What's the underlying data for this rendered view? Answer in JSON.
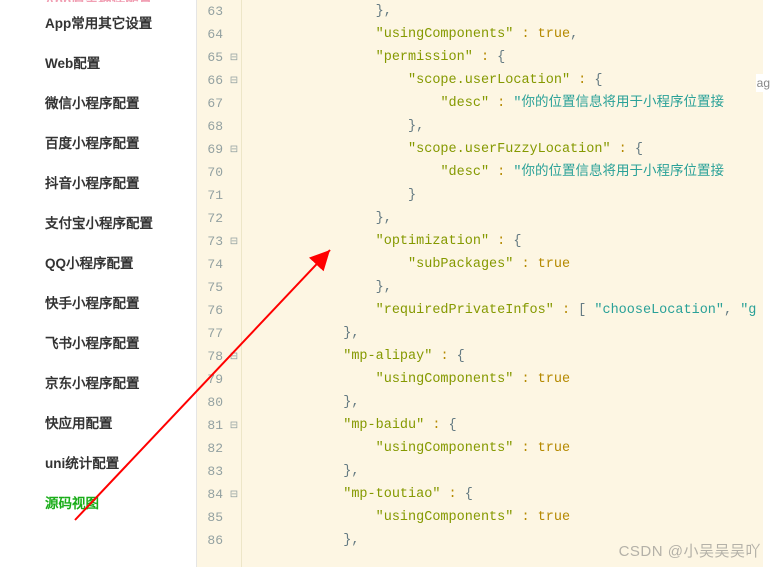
{
  "sidebar": {
    "items": [
      {
        "label": "App原生插件配置"
      },
      {
        "label": "App常用其它设置"
      },
      {
        "label": "Web配置"
      },
      {
        "label": "微信小程序配置"
      },
      {
        "label": "百度小程序配置"
      },
      {
        "label": "抖音小程序配置"
      },
      {
        "label": "支付宝小程序配置"
      },
      {
        "label": "QQ小程序配置"
      },
      {
        "label": "快手小程序配置"
      },
      {
        "label": "飞书小程序配置"
      },
      {
        "label": "京东小程序配置"
      },
      {
        "label": "快应用配置"
      },
      {
        "label": "uni统计配置"
      },
      {
        "label": "源码视图"
      }
    ]
  },
  "editor": {
    "lines": [
      {
        "num": 63,
        "fold": "",
        "indent": 4,
        "tokens": [
          {
            "t": "},",
            "c": "p"
          }
        ]
      },
      {
        "num": 64,
        "fold": "",
        "indent": 4,
        "tokens": [
          {
            "t": "\"usingComponents\"",
            "c": "k"
          },
          {
            "t": " : ",
            "c": "c"
          },
          {
            "t": "true",
            "c": "b"
          },
          {
            "t": ",",
            "c": "p"
          }
        ]
      },
      {
        "num": 65,
        "fold": "⊟",
        "indent": 4,
        "tokens": [
          {
            "t": "\"permission\"",
            "c": "k"
          },
          {
            "t": " : ",
            "c": "c"
          },
          {
            "t": "{",
            "c": "p"
          }
        ]
      },
      {
        "num": 66,
        "fold": "⊟",
        "indent": 5,
        "tokens": [
          {
            "t": "\"scope.userLocation\"",
            "c": "k"
          },
          {
            "t": " : ",
            "c": "c"
          },
          {
            "t": "{",
            "c": "p"
          }
        ]
      },
      {
        "num": 67,
        "fold": "",
        "indent": 6,
        "tokens": [
          {
            "t": "\"desc\"",
            "c": "k"
          },
          {
            "t": " : ",
            "c": "c"
          },
          {
            "t": "\"你的位置信息将用于小程序位置接",
            "c": "s"
          }
        ]
      },
      {
        "num": 68,
        "fold": "",
        "indent": 5,
        "tokens": [
          {
            "t": "},",
            "c": "p"
          }
        ]
      },
      {
        "num": 69,
        "fold": "⊟",
        "indent": 5,
        "tokens": [
          {
            "t": "\"scope.userFuzzyLocation\"",
            "c": "k"
          },
          {
            "t": " : ",
            "c": "c"
          },
          {
            "t": "{",
            "c": "p"
          }
        ]
      },
      {
        "num": 70,
        "fold": "",
        "indent": 6,
        "tokens": [
          {
            "t": "\"desc\"",
            "c": "k"
          },
          {
            "t": " : ",
            "c": "c"
          },
          {
            "t": "\"你的位置信息将用于小程序位置接",
            "c": "s"
          }
        ]
      },
      {
        "num": 71,
        "fold": "",
        "indent": 5,
        "tokens": [
          {
            "t": "}",
            "c": "p"
          }
        ]
      },
      {
        "num": 72,
        "fold": "",
        "indent": 4,
        "tokens": [
          {
            "t": "},",
            "c": "p"
          }
        ]
      },
      {
        "num": 73,
        "fold": "⊟",
        "indent": 4,
        "tokens": [
          {
            "t": "\"optimization\"",
            "c": "k"
          },
          {
            "t": " : ",
            "c": "c"
          },
          {
            "t": "{",
            "c": "p"
          }
        ]
      },
      {
        "num": 74,
        "fold": "",
        "indent": 5,
        "tokens": [
          {
            "t": "\"subPackages\"",
            "c": "k"
          },
          {
            "t": " : ",
            "c": "c"
          },
          {
            "t": "true",
            "c": "b"
          }
        ]
      },
      {
        "num": 75,
        "fold": "",
        "indent": 4,
        "tokens": [
          {
            "t": "},",
            "c": "p"
          }
        ]
      },
      {
        "num": 76,
        "fold": "",
        "indent": 4,
        "tokens": [
          {
            "t": "\"requiredPrivateInfos\"",
            "c": "k"
          },
          {
            "t": " : ",
            "c": "c"
          },
          {
            "t": "[ ",
            "c": "p"
          },
          {
            "t": "\"chooseLocation\"",
            "c": "s"
          },
          {
            "t": ", ",
            "c": "p"
          },
          {
            "t": "\"g",
            "c": "s"
          }
        ]
      },
      {
        "num": 77,
        "fold": "",
        "indent": 3,
        "tokens": [
          {
            "t": "},",
            "c": "p"
          }
        ]
      },
      {
        "num": 78,
        "fold": "⊟",
        "indent": 3,
        "tokens": [
          {
            "t": "\"mp-alipay\"",
            "c": "k"
          },
          {
            "t": " : ",
            "c": "c"
          },
          {
            "t": "{",
            "c": "p"
          }
        ]
      },
      {
        "num": 79,
        "fold": "",
        "indent": 4,
        "tokens": [
          {
            "t": "\"usingComponents\"",
            "c": "k"
          },
          {
            "t": " : ",
            "c": "c"
          },
          {
            "t": "true",
            "c": "b"
          }
        ]
      },
      {
        "num": 80,
        "fold": "",
        "indent": 3,
        "tokens": [
          {
            "t": "},",
            "c": "p"
          }
        ]
      },
      {
        "num": 81,
        "fold": "⊟",
        "indent": 3,
        "tokens": [
          {
            "t": "\"mp-baidu\"",
            "c": "k"
          },
          {
            "t": " : ",
            "c": "c"
          },
          {
            "t": "{",
            "c": "p"
          }
        ]
      },
      {
        "num": 82,
        "fold": "",
        "indent": 4,
        "tokens": [
          {
            "t": "\"usingComponents\"",
            "c": "k"
          },
          {
            "t": " : ",
            "c": "c"
          },
          {
            "t": "true",
            "c": "b"
          }
        ]
      },
      {
        "num": 83,
        "fold": "",
        "indent": 3,
        "tokens": [
          {
            "t": "},",
            "c": "p"
          }
        ]
      },
      {
        "num": 84,
        "fold": "⊟",
        "indent": 3,
        "tokens": [
          {
            "t": "\"mp-toutiao\"",
            "c": "k"
          },
          {
            "t": " : ",
            "c": "c"
          },
          {
            "t": "{",
            "c": "p"
          }
        ]
      },
      {
        "num": 85,
        "fold": "",
        "indent": 4,
        "tokens": [
          {
            "t": "\"usingComponents\"",
            "c": "k"
          },
          {
            "t": " : ",
            "c": "c"
          },
          {
            "t": "true",
            "c": "b"
          }
        ]
      },
      {
        "num": 86,
        "fold": "",
        "indent": 3,
        "tokens": [
          {
            "t": "},",
            "c": "p"
          }
        ]
      }
    ]
  },
  "watermark": "CSDN @小吴吴吴吖",
  "rightLabel": "ag"
}
